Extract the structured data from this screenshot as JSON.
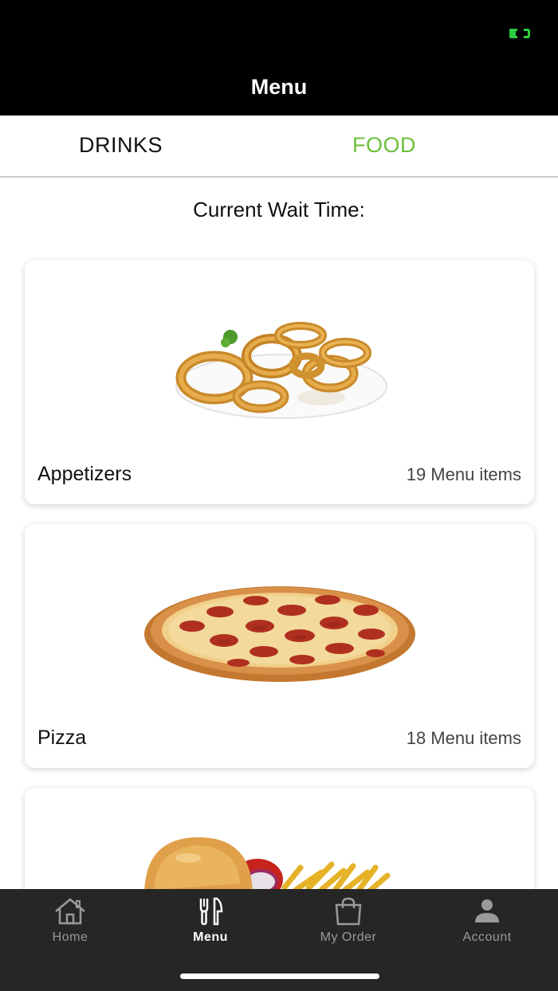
{
  "nav": {
    "title": "Menu"
  },
  "tabs": [
    {
      "label": "DRINKS"
    },
    {
      "label": "FOOD"
    }
  ],
  "wait_time": {
    "label": "Current Wait Time:"
  },
  "categories": [
    {
      "title": "Appetizers",
      "count": "19 Menu items",
      "image": "onion-rings-image"
    },
    {
      "title": "Pizza",
      "count": "18 Menu items",
      "image": "pepperoni-pizza-image"
    },
    {
      "title": "",
      "count": "",
      "image": "burger-fries-image"
    }
  ],
  "tab_bar": {
    "items": [
      {
        "label": "Home",
        "icon": "house-icon"
      },
      {
        "label": "Menu",
        "icon": "fork-knife-icon"
      },
      {
        "label": "My Order",
        "icon": "shopping-bag-icon"
      },
      {
        "label": "Account",
        "icon": "person-icon"
      }
    ]
  },
  "colors": {
    "accent": "#6cbf3a",
    "header": "#000000",
    "tab_bar": "#262626"
  }
}
